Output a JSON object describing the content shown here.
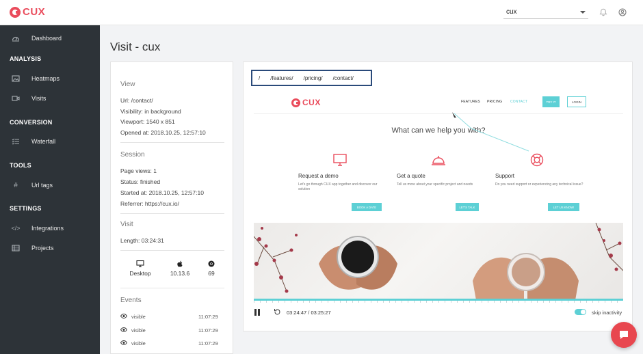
{
  "topbar": {
    "logo_text": "CUX",
    "project_select_value": "cux"
  },
  "sidebar": {
    "dashboard": "Dashboard",
    "analysis_heading": "ANALYSIS",
    "heatmaps": "Heatmaps",
    "visits": "Visits",
    "conversion_heading": "CONVERSION",
    "waterfall": "Waterfall",
    "tools_heading": "TOOLS",
    "url_tags": "Url tags",
    "settings_heading": "SETTINGS",
    "integrations": "Integrations",
    "projects": "Projects"
  },
  "page": {
    "title": "Visit - cux"
  },
  "details": {
    "view_heading": "View",
    "url": "Url: /contact/",
    "visibility": "Visibility: in background",
    "viewport": "Viewport: 1540 x 851",
    "opened_at": "Opened at: 2018.10.25, 12:57:10",
    "session_heading": "Session",
    "page_views": "Page views: 1",
    "status": "Status: finished",
    "started_at": "Started at: 2018.10.25, 12:57:10",
    "referrer": "Referrer: https://cux.io/",
    "visit_heading": "Visit",
    "length": "Length: 03:24:31",
    "device": "Desktop",
    "os_version": "10.13.6",
    "browser_version": "69",
    "events_heading": "Events",
    "events": [
      {
        "type": "visible",
        "time": "11:07:29"
      },
      {
        "type": "visible",
        "time": "11:07:29"
      },
      {
        "type": "visible",
        "time": "11:07:29"
      }
    ]
  },
  "player": {
    "url_tabs": [
      "/",
      "/features/",
      "/pricing/",
      "/contact/"
    ],
    "current_time": "03:24:47 / 03:25:27",
    "skip_label": "skip inactivity",
    "skip_inactivity": true
  },
  "site": {
    "logo_text": "CUX",
    "nav": {
      "features": "FEATURES",
      "pricing": "PRICING",
      "contact": "CONTACT",
      "try_it": "TRY IT",
      "login": "LOGIN"
    },
    "headline": "What can we help you with?",
    "features": [
      {
        "title": "Request a demo",
        "desc": "Let's go through CUX app together and discover our solution",
        "button": "BOOK A DATE"
      },
      {
        "title": "Get a quote",
        "desc": "Tell us more about your specific project and needs",
        "button": "LET'S TALK"
      },
      {
        "title": "Support",
        "desc": "Do you need support or experiencing any technical issue?",
        "button": "LET US KNOW!"
      }
    ]
  },
  "colors": {
    "brand": "#ea4c5c",
    "sidebar": "#2d3338",
    "accent": "#5dd0d5",
    "url_tabs_border": "#2a4a7a"
  }
}
